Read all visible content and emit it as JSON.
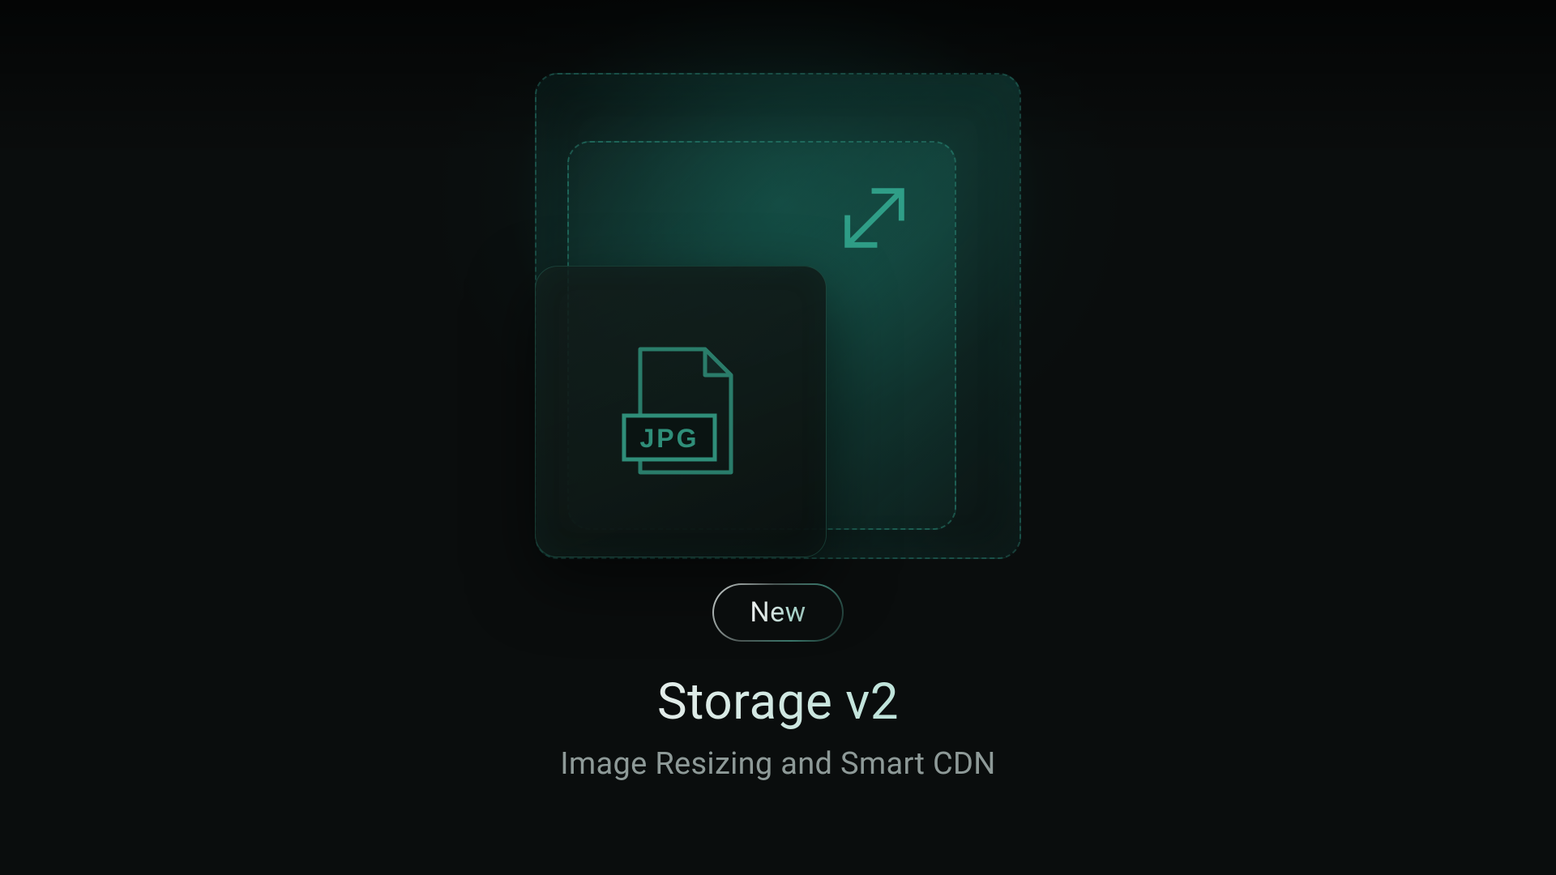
{
  "hero": {
    "badge_label": "New",
    "title": "Storage v2",
    "subtitle": "Image Resizing and Smart CDN",
    "file_type_label": "JPG",
    "icons": {
      "resize": "resize-arrow-icon",
      "file": "jpg-file-icon"
    },
    "colors": {
      "accent": "#35b59a",
      "accent_dim": "#2a7d6e",
      "text_muted": "#8e9a98",
      "bg": "#0a0d0d"
    }
  }
}
